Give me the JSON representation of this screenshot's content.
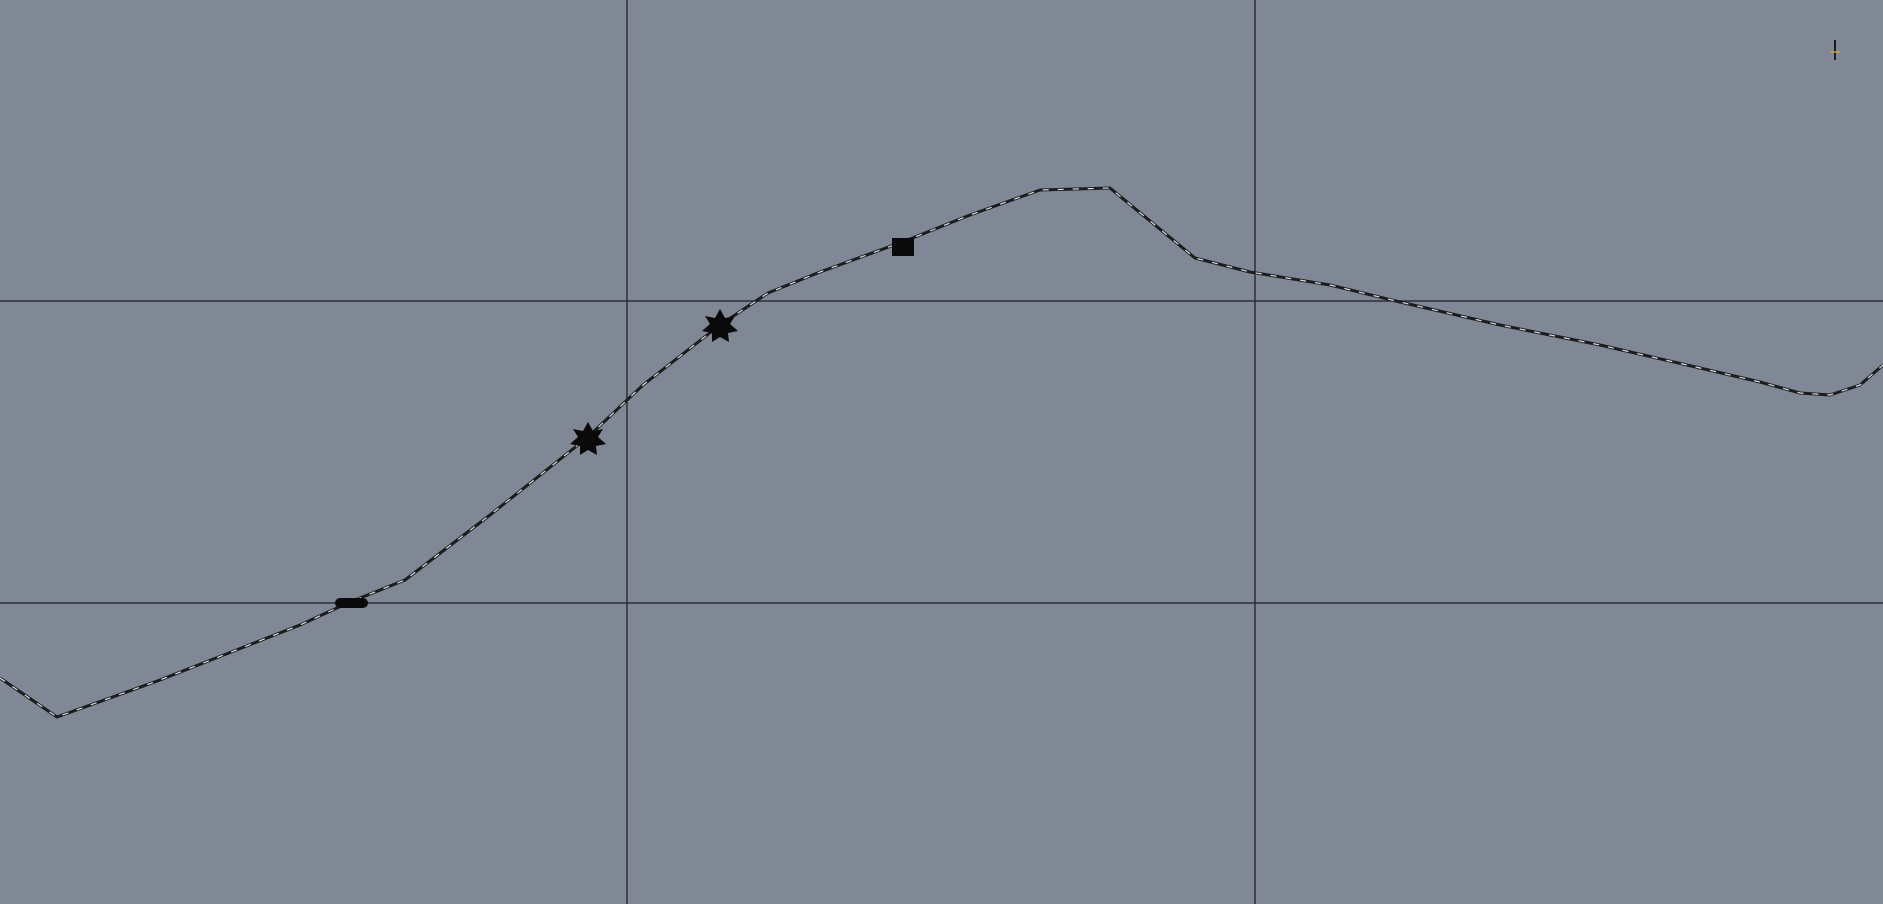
{
  "canvas": {
    "background_color": "#808795",
    "grid_color": "#2a2e38",
    "curve_color": "#1c1c1c",
    "curve_highlight_color": "#d8dce4",
    "control_point_color": "#0a0a0a",
    "grid_columns": 3,
    "grid_rows": 3
  },
  "curve": {
    "control_point_shapes": [
      "bar",
      "star",
      "star",
      "square"
    ]
  }
}
